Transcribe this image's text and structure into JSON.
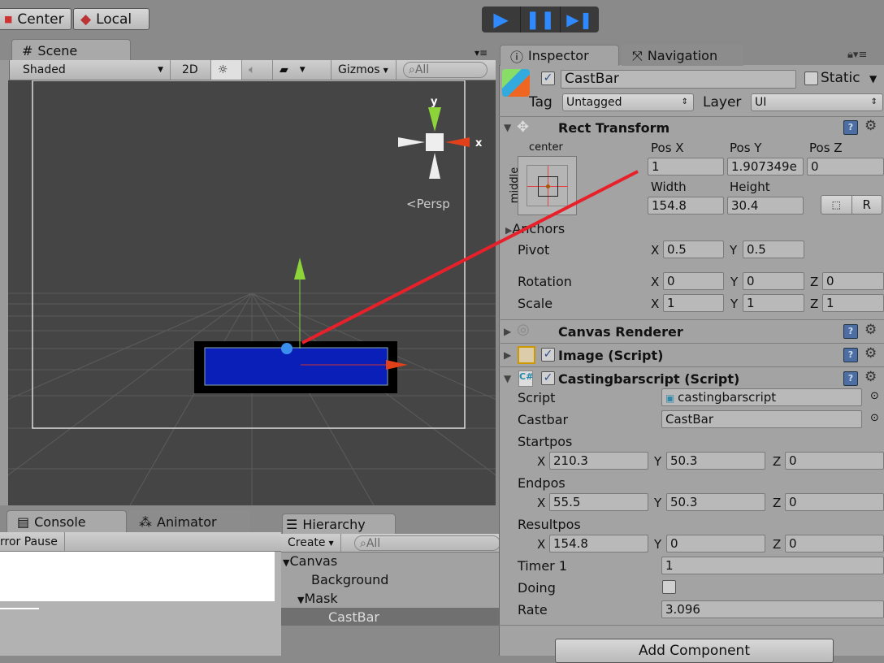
{
  "toolbar": {
    "pivot_label": "Center",
    "space_label": "Local",
    "play_icon": "play-icon",
    "pause_icon": "pause-icon",
    "step_icon": "step-icon",
    "accent": "#2f7fe0"
  },
  "scene": {
    "tab_label": "Scene",
    "shading": "Shaded",
    "mode_2d": "2D",
    "gizmos": "Gizmos",
    "search_placeholder": "All",
    "persp_label": "Persp",
    "axis_y": "y",
    "axis_x": "x",
    "selected_color": "#0a1fb8"
  },
  "console": {
    "tab_label": "Console",
    "animator_label": "Animator",
    "error_pause": "rror Pause"
  },
  "hierarchy": {
    "tab_label": "Hierarchy",
    "create_label": "Create",
    "search_placeholder": "All",
    "items": [
      {
        "label": "Canvas",
        "expanded": true
      },
      {
        "label": "Background"
      },
      {
        "label": "Mask",
        "expanded": true
      },
      {
        "label": "CastBar",
        "selected": true
      }
    ]
  },
  "inspector": {
    "tab_label": "Inspector",
    "nav_tab_label": "Navigation",
    "object_name": "CastBar",
    "active": true,
    "static_label": "Static",
    "static": false,
    "tag_label": "Tag",
    "tag_value": "Untagged",
    "layer_label": "Layer",
    "layer_value": "UI",
    "rect_transform": {
      "title": "Rect Transform",
      "anchor_h": "center",
      "anchor_v": "middle",
      "pos_x_label": "Pos X",
      "pos_y_label": "Pos Y",
      "pos_z_label": "Pos Z",
      "pos_x": "1",
      "pos_y": "1.907349e",
      "pos_z": "0",
      "width_label": "Width",
      "height_label": "Height",
      "width": "154.8",
      "height": "30.4",
      "raw_button": "R",
      "anchors_label": "Anchors",
      "pivot_label": "Pivot",
      "pivot_x": "0.5",
      "pivot_y": "0.5",
      "rotation_label": "Rotation",
      "rotation": [
        "0",
        "0",
        "0"
      ],
      "scale_label": "Scale",
      "scale": [
        "1",
        "1",
        "1"
      ]
    },
    "canvas_renderer": "Canvas Renderer",
    "image_script": "Image (Script)",
    "casting_script": "Castingbarscript (Script)",
    "fields": {
      "script_label": "Script",
      "script_value": "castingbarscript",
      "castbar_label": "Castbar",
      "castbar_value": "CastBar",
      "startpos_label": "Startpos",
      "startpos": [
        "210.3",
        "50.3",
        "0"
      ],
      "endpos_label": "Endpos",
      "endpos": [
        "55.5",
        "50.3",
        "0"
      ],
      "resultpos_label": "Resultpos",
      "resultpos": [
        "154.8",
        "0",
        "0"
      ],
      "timer_label": "Timer 1",
      "timer_value": "1",
      "doing_label": "Doing",
      "doing": false,
      "rate_label": "Rate",
      "rate_value": "3.096"
    },
    "axis": {
      "x": "X",
      "y": "Y",
      "z": "Z"
    },
    "add_component": "Add Component"
  }
}
